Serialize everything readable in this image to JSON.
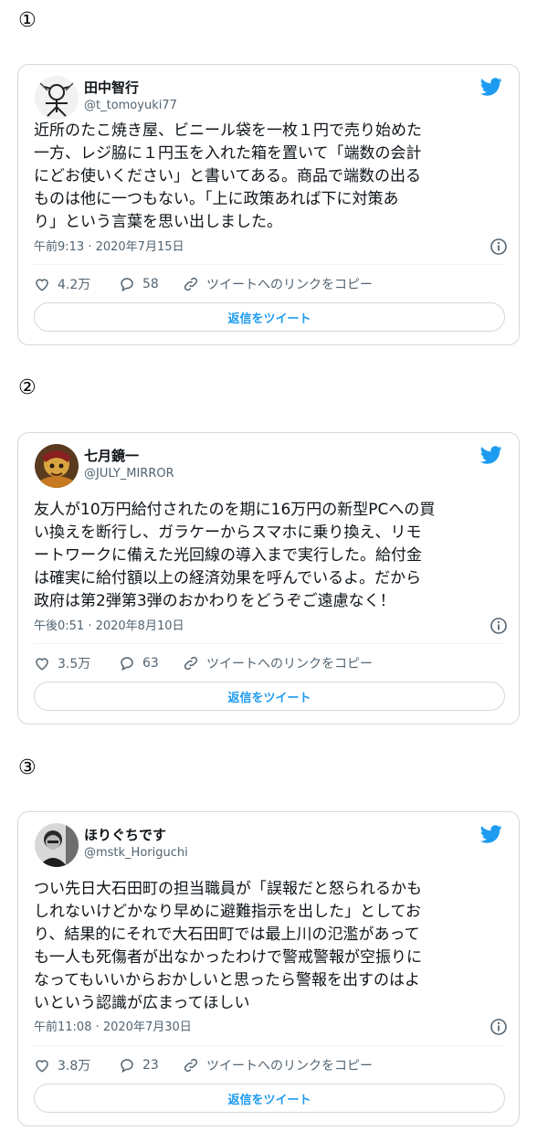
{
  "tweets": [
    {
      "marker": "①",
      "name": "田中智行",
      "handle": "@t_tomoyuki77",
      "lines": [
        "近所のたこ焼き屋、ビニール袋を一枚１円で売り始めた",
        "一方、レジ脇に１円玉を入れた箱を置いて「端数の会計",
        "にどお使いください」と書いてある。商品で端数の出る",
        "ものは他に一つもない。「上に政策あれば下に対策あ",
        "り」という言葉を思い出しました。"
      ],
      "timestamp": "午前9:13 · 2020年7月15日",
      "likes": "4.2万",
      "replies": "58",
      "copy_link": "ツイートへのリンクをコピー",
      "reply_button": "返信をツイート"
    },
    {
      "marker": "②",
      "name": "七月鏡一",
      "handle": "@JULY_MIRROR",
      "lines": [
        "友人が10万円給付されたのを期に16万円の新型PCへの買",
        "い換えを断行し、ガラケーからスマホに乗り換え、リモ",
        "ートワークに備えた光回線の導入まで実行した。給付金",
        "は確実に給付額以上の経済効果を呼んでいるよ。だから",
        "政府は第2弾第3弾のおかわりをどうぞご遠慮なく！"
      ],
      "timestamp": "午後0:51 · 2020年8月10日",
      "likes": "3.5万",
      "replies": "63",
      "copy_link": "ツイートへのリンクをコピー",
      "reply_button": "返信をツイート"
    },
    {
      "marker": "③",
      "name": "ほりぐちです",
      "handle": "@mstk_Horiguchi",
      "lines": [
        "つい先日大石田町の担当職員が「誤報だと怒られるかも",
        "しれないけどかなり早めに避難指示を出した」としてお",
        "り、結果的にそれで大石田町では最上川の氾濫があって",
        "も一人も死傷者が出なかったわけで警戒警報が空振りに",
        "なってもいいからおかしいと思ったら警報を出すのはよ",
        "いという認識が広まってほしい"
      ],
      "timestamp": "午前11:08 · 2020年7月30日",
      "likes": "3.8万",
      "replies": "23",
      "copy_link": "ツイートへのリンクをコピー",
      "reply_button": "返信をツイート"
    }
  ],
  "colors": {
    "accent": "#1d9bf0",
    "muted": "#536471",
    "border": "#cfd9de",
    "text": "#0f1419"
  },
  "icons": [
    "twitter-bird-icon",
    "info-icon",
    "heart-icon",
    "reply-icon",
    "link-icon"
  ]
}
